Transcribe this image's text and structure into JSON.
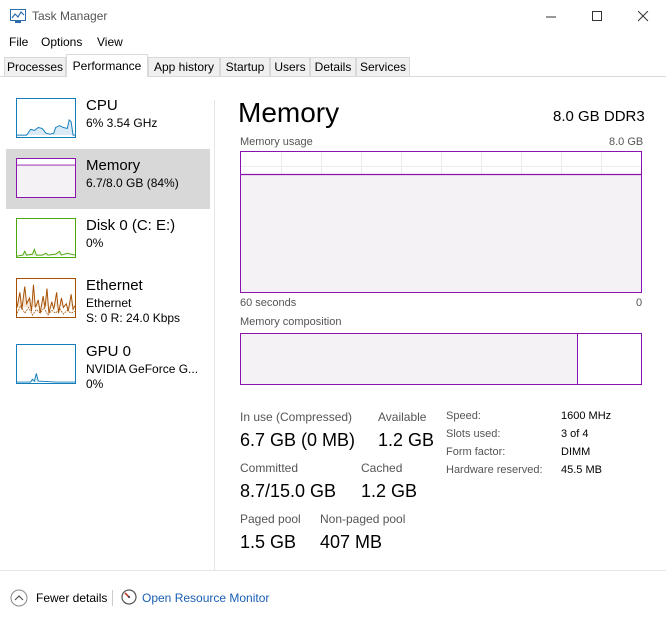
{
  "window": {
    "title": "Task Manager",
    "controls": [
      "minimize",
      "maximize",
      "close"
    ]
  },
  "menu": {
    "file": "File",
    "options": "Options",
    "view": "View"
  },
  "tabs": [
    {
      "label": "Processes"
    },
    {
      "label": "Performance",
      "active": true
    },
    {
      "label": "App history"
    },
    {
      "label": "Startup"
    },
    {
      "label": "Users"
    },
    {
      "label": "Details"
    },
    {
      "label": "Services"
    }
  ],
  "sidebar": {
    "items": [
      {
        "title": "CPU",
        "line1": "6% 3.54 GHz",
        "line2": "",
        "accent": "#117dbb"
      },
      {
        "title": "Memory",
        "line1": "6.7/8.0 GB (84%)",
        "line2": "",
        "accent": "#8b12ae",
        "selected": true
      },
      {
        "title": "Disk 0 (C: E:)",
        "line1": "0%",
        "line2": "",
        "accent": "#4da60c"
      },
      {
        "title": "Ethernet",
        "line1": "Ethernet",
        "line2": "S: 0 R: 24.0 Kbps",
        "accent": "#a74f01"
      },
      {
        "title": "GPU 0",
        "line1": "NVIDIA GeForce G...",
        "line2": "0%",
        "accent": "#117dbb"
      }
    ]
  },
  "detail": {
    "title": "Memory",
    "spec": "8.0 GB DDR3",
    "usage_label": "Memory usage",
    "usage_max": "8.0 GB",
    "time_left": "60 seconds",
    "time_right": "0",
    "usage_fraction": 0.84,
    "composition_label": "Memory composition",
    "composition_inuse_fraction": 0.84,
    "stats": {
      "in_use_label": "In use (Compressed)",
      "in_use_value": "6.7 GB (0 MB)",
      "available_label": "Available",
      "available_value": "1.2 GB",
      "committed_label": "Committed",
      "committed_value": "8.7/15.0 GB",
      "cached_label": "Cached",
      "cached_value": "1.2 GB",
      "paged_label": "Paged pool",
      "paged_value": "1.5 GB",
      "nonpaged_label": "Non-paged pool",
      "nonpaged_value": "407 MB"
    },
    "specs": [
      {
        "label": "Speed:",
        "value": "1600 MHz"
      },
      {
        "label": "Slots used:",
        "value": "3 of 4"
      },
      {
        "label": "Form factor:",
        "value": "DIMM"
      },
      {
        "label": "Hardware reserved:",
        "value": "45.5 MB"
      }
    ]
  },
  "footer": {
    "fewer_details": "Fewer details",
    "resource_monitor": "Open Resource Monitor"
  },
  "colors": {
    "memory": "#8b12ae",
    "cpu": "#117dbb",
    "disk": "#4da60c",
    "ethernet": "#a74f01",
    "link": "#1a5fb4"
  }
}
